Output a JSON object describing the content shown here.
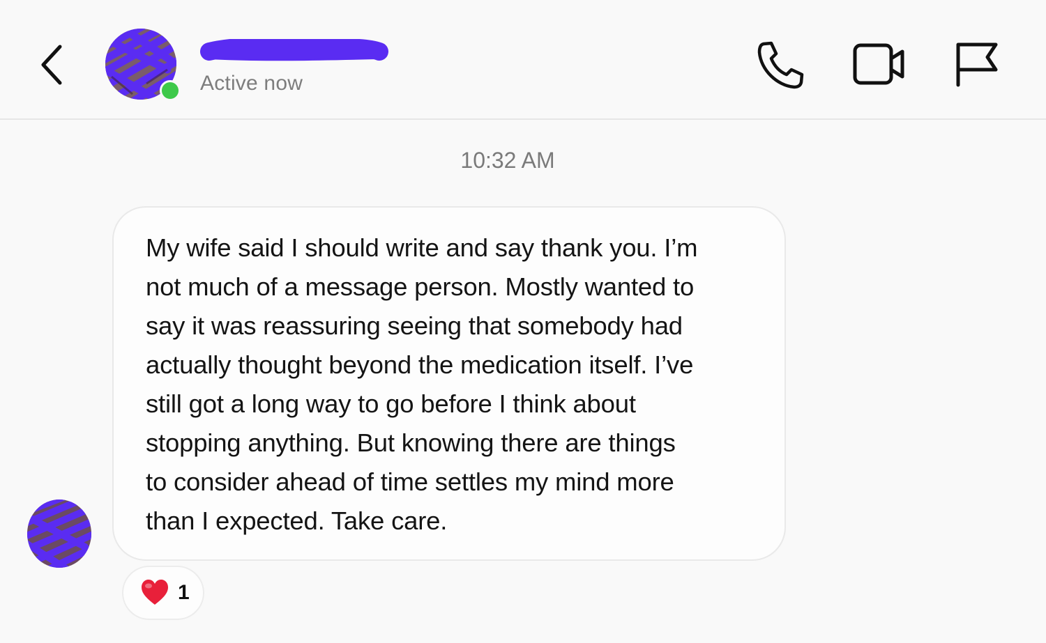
{
  "header": {
    "status": "Active now",
    "icons": {
      "back": "chevron-left-icon",
      "call": "phone-icon",
      "video": "video-camera-icon",
      "report": "flag-icon"
    }
  },
  "conversation": {
    "timestamp": "10:32 AM",
    "messages": [
      {
        "text": "My wife said I should write and say thank you. I’m\nnot much of a message person. Mostly wanted to\nsay it was reassuring seeing that somebody had\nactually thought beyond the medication itself. I’ve\nstill got a long way to go before I think about\nstopping anything. But knowing there are things\nto consider ahead of time settles my mind more\nthan I expected. Take care.",
        "reaction": {
          "emoji": "heart",
          "count": "1"
        }
      }
    ]
  },
  "colors": {
    "redaction": "#5a2cf2",
    "online": "#3ec94a",
    "heart": "#e8203a"
  }
}
